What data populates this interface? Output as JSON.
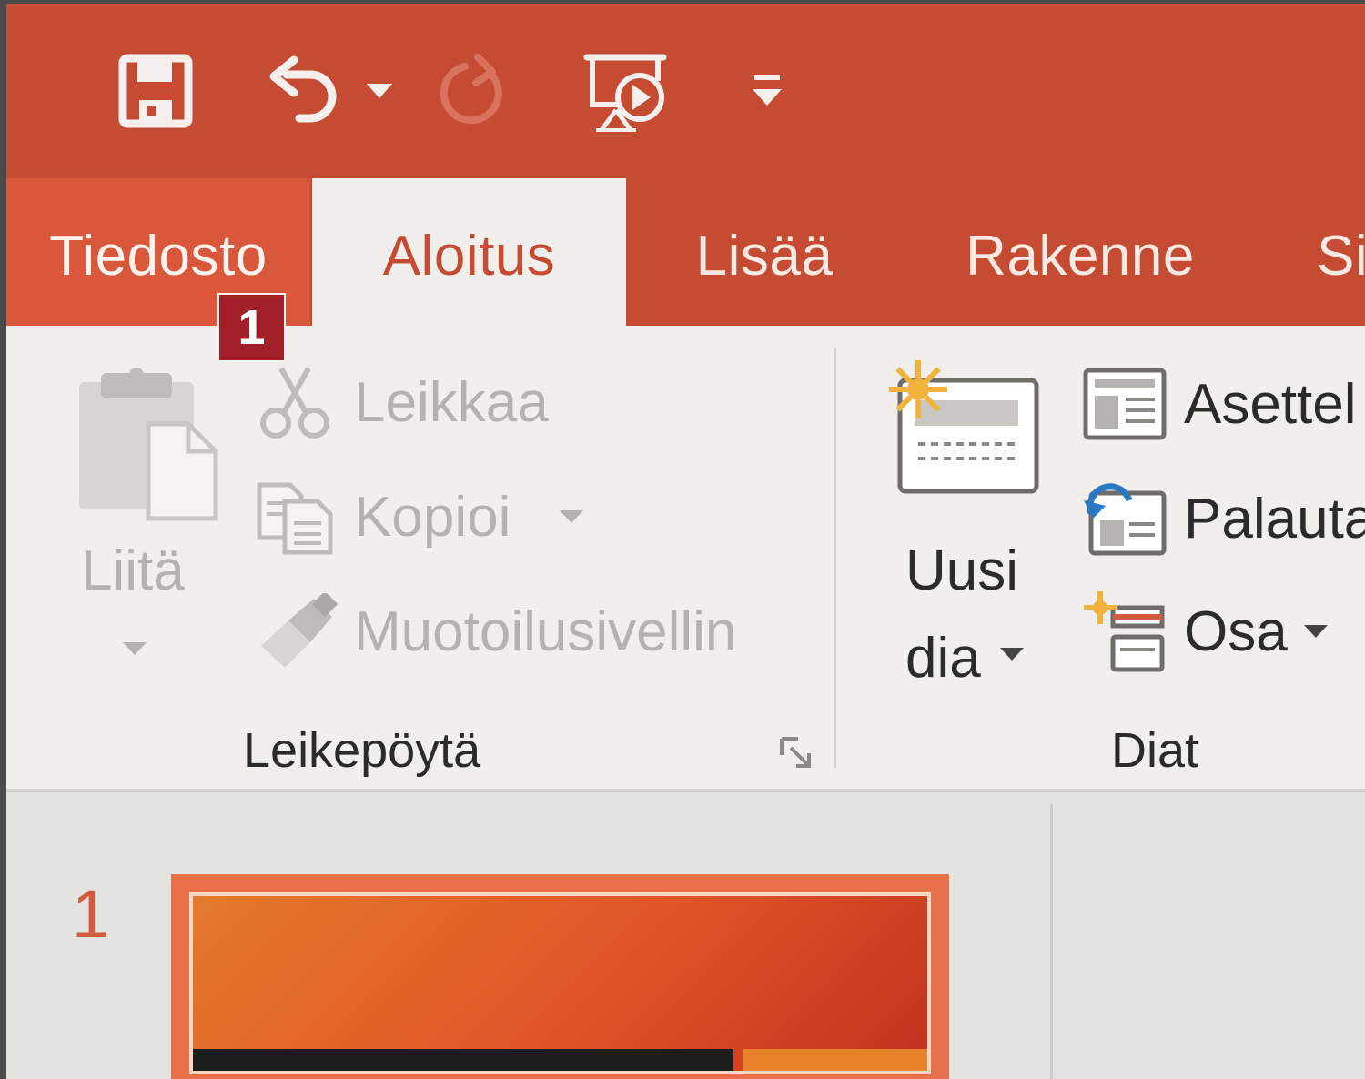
{
  "colors": {
    "accent": "#c54b33",
    "file_tab": "#d9583b",
    "ribbon_bg": "#f0efeb",
    "keytip": "#a21f2a",
    "disabled_text": "#b3b2ae"
  },
  "qat": {
    "icons": [
      "save-icon",
      "undo-icon",
      "dropdown-arrow-icon",
      "redo-icon",
      "start-slideshow-icon",
      "customize-qat-icon"
    ]
  },
  "tabs": {
    "file": "Tiedosto",
    "home": "Aloitus",
    "insert": "Lisää",
    "design": "Rakenne",
    "partial": "Si"
  },
  "keytip": {
    "label": "1"
  },
  "clipboard": {
    "paste": "Liitä",
    "cut": "Leikkaa",
    "copy": "Kopioi",
    "format_painter": "Muotoilusivellin",
    "group_label": "Leikepöytä"
  },
  "slides": {
    "new_slide_line1": "Uusi",
    "new_slide_line2": "dia",
    "layout": "Asettel",
    "reset": "Palauta",
    "section": "Osa",
    "group_label": "Diat"
  },
  "slide_pane": {
    "slide_number": "1"
  }
}
